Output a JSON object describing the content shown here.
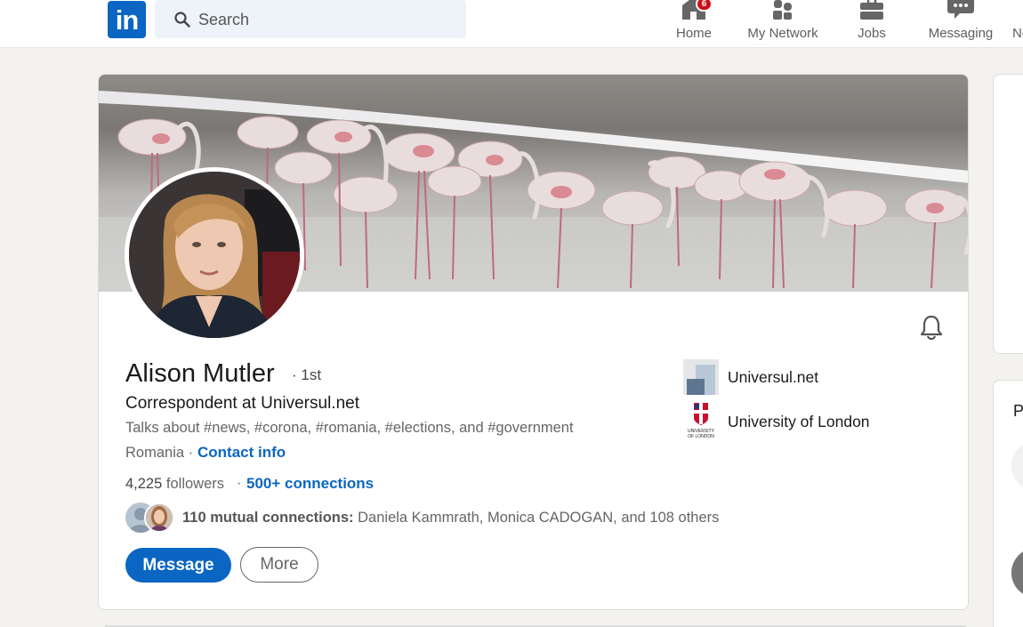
{
  "nav": {
    "logo_text": "in",
    "search_placeholder": "Search",
    "items": [
      {
        "label": "Home",
        "icon": "home-icon",
        "badge": "6"
      },
      {
        "label": "My Network",
        "icon": "network-icon"
      },
      {
        "label": "Jobs",
        "icon": "briefcase-icon"
      },
      {
        "label": "Messaging",
        "icon": "messaging-icon"
      },
      {
        "label": "No",
        "icon": "bell-icon"
      }
    ]
  },
  "profile": {
    "name": "Alison Mutler",
    "degree": "· 1st",
    "headline": "Correspondent at Universul.net",
    "talks_about": "Talks about #news, #corona, #romania, #elections, and #government",
    "location": "Romania ·",
    "contact_info": "Contact info",
    "followers_count": "4,225",
    "followers_label": "followers",
    "separator": "·",
    "connections": "500+ connections",
    "mutual_label": "110 mutual connections:",
    "mutual_names": "Daniela Kammrath, Monica CADOGAN, and 108 others",
    "buttons": {
      "message": "Message",
      "more": "More"
    },
    "experience": "Universul.net",
    "education": "University of London",
    "education_logo_text": "UNIVERSITY OF LONDON"
  },
  "sidebar": {
    "section_initial": "P"
  },
  "colors": {
    "brand": "#0a66c2",
    "background": "#f3f2ef",
    "notification_badge": "#cc1016"
  }
}
